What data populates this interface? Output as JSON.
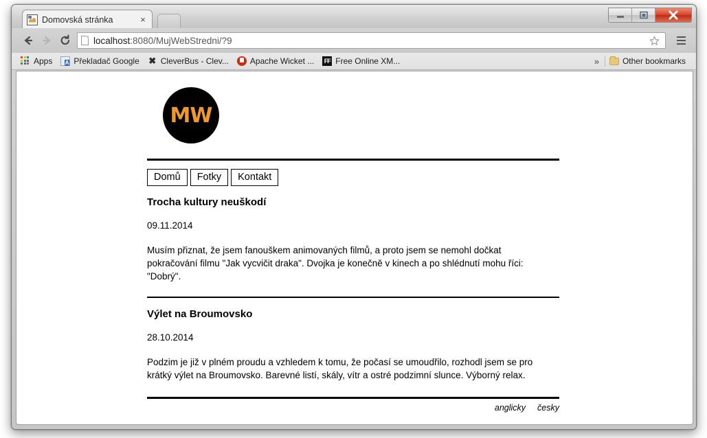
{
  "browser": {
    "tab": {
      "title": "Domovská stránka",
      "close_label": "×",
      "favicon": "wicket-favicon"
    },
    "window_controls": {
      "minimize": "minimize-icon",
      "maximize": "maximize-icon",
      "close": "close-icon"
    },
    "toolbar": {
      "back": "back-arrow-icon",
      "forward": "forward-arrow-icon",
      "reload": "reload-icon",
      "url_host": "localhost",
      "url_path": ":8080/MujWebStredni/?9",
      "url_full": "localhost:8080/MujWebStredni/?9",
      "star": "star-icon",
      "menu": "hamburger-menu-icon"
    },
    "bookmarks": {
      "items": [
        {
          "label": "Apps",
          "icon": "apps-grid-icon"
        },
        {
          "label": "Překladač Google",
          "icon": "translate-icon"
        },
        {
          "label": "CleverBus - Clev...",
          "icon": "scissors-x-icon"
        },
        {
          "label": "Apache Wicket ...",
          "icon": "wicket-icon"
        },
        {
          "label": "Free Online XM...",
          "icon": "ff-icon"
        }
      ],
      "overflow": "»",
      "other": {
        "label": "Other bookmarks",
        "icon": "folder-icon"
      }
    }
  },
  "site": {
    "logo": {
      "text": "MW",
      "bg": "#000000",
      "fg": "#ef982f"
    },
    "nav": [
      {
        "label": "Domů"
      },
      {
        "label": "Fotky"
      },
      {
        "label": "Kontakt"
      }
    ],
    "articles": [
      {
        "title": "Trocha kultury neuškodí",
        "date": "09.11.2014",
        "body": "Musím přiznat, že jsem fanouškem animovaných filmů, a proto jsem se nemohl dočkat pokračování filmu \"Jak vycvičit draka\". Dvojka je konečně v kinech a po shlédnutí mohu říci: \"Dobrý\"."
      },
      {
        "title": "Výlet na Broumovsko",
        "date": "28.10.2014",
        "body": "Podzim je již v plném proudu a vzhledem k tomu, že počasí se umoudřilo, rozhodl jsem se pro krátký výlet na Broumovsko. Barevné listí, skály, vítr a ostré podzimní slunce. Výborný relax."
      }
    ],
    "footer": {
      "lang_en": "anglicky",
      "lang_cs": "česky"
    }
  }
}
